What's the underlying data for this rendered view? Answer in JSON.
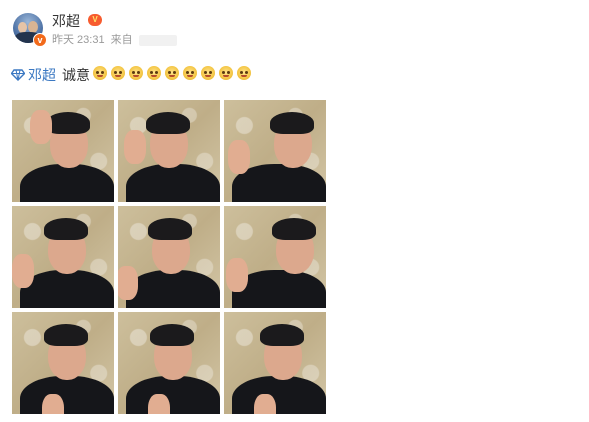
{
  "post": {
    "author": {
      "name": "邓超",
      "verified_badge": "v",
      "vip_badge": "V"
    },
    "meta": {
      "time": "昨天 23:31",
      "source_prefix": "来自"
    },
    "content": {
      "mention": "邓超",
      "text": "诚意",
      "emoji_count": 9,
      "emoji_icon": "dog-face-emoji"
    },
    "photos": [
      {
        "name": "photo-1"
      },
      {
        "name": "photo-2"
      },
      {
        "name": "photo-3"
      },
      {
        "name": "photo-4"
      },
      {
        "name": "photo-5"
      },
      {
        "name": "photo-6"
      },
      {
        "name": "photo-7"
      },
      {
        "name": "photo-8"
      },
      {
        "name": "photo-9"
      }
    ]
  },
  "colors": {
    "link": "#3b78c2",
    "text": "#333333",
    "meta": "#9a9a9a",
    "vip": "#f75c2f"
  }
}
